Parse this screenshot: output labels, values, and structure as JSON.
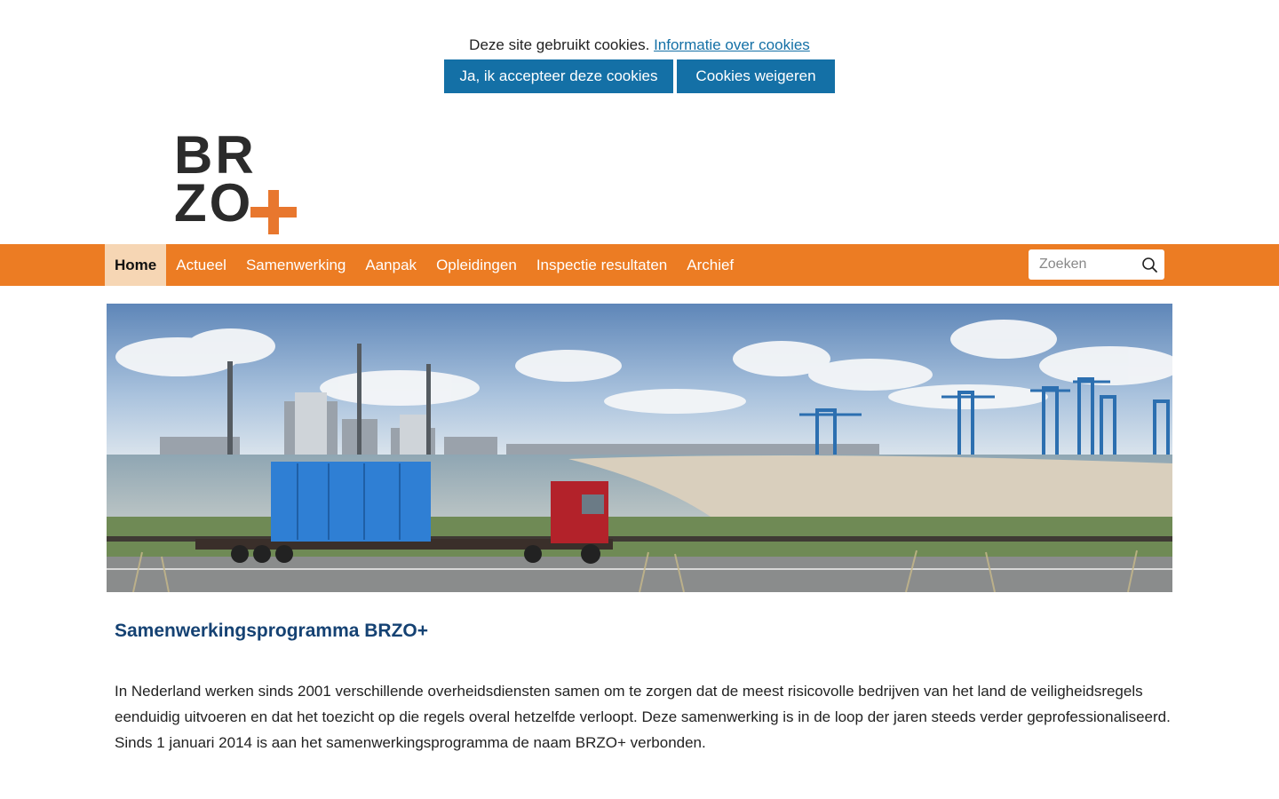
{
  "cookie": {
    "text": "Deze site gebruikt cookies.",
    "link": "Informatie over cookies",
    "accept": "Ja, ik accepteer deze cookies",
    "refuse": "Cookies weigeren"
  },
  "logo": {
    "line1": "BR",
    "line2": "ZO",
    "plus": "+"
  },
  "nav": {
    "items": [
      {
        "label": "Home",
        "active": true
      },
      {
        "label": "Actueel"
      },
      {
        "label": "Samenwerking"
      },
      {
        "label": "Aanpak"
      },
      {
        "label": "Opleidingen"
      },
      {
        "label": "Inspectie resultaten"
      },
      {
        "label": "Archief"
      }
    ],
    "search_placeholder": "Zoeken"
  },
  "main": {
    "title": "Samenwerkingsprogramma BRZO+",
    "body": "In Nederland werken sinds 2001 verschillende overheidsdiensten samen om te zorgen dat de meest risicovolle bedrijven van het land de veiligheidsregels eenduidig uitvoeren en dat het toezicht op die regels overal hetzelfde verloopt. Deze samenwerking is in de loop der jaren steeds verder geprofessionaliseerd. Sinds 1 januari 2014 is aan het samenwerkingsprogramma de naam BRZO+ verbonden."
  },
  "colors": {
    "nav": "#ec7c23",
    "button": "#1470a6",
    "title": "#154273",
    "active_tab": "#f6d6b4"
  }
}
